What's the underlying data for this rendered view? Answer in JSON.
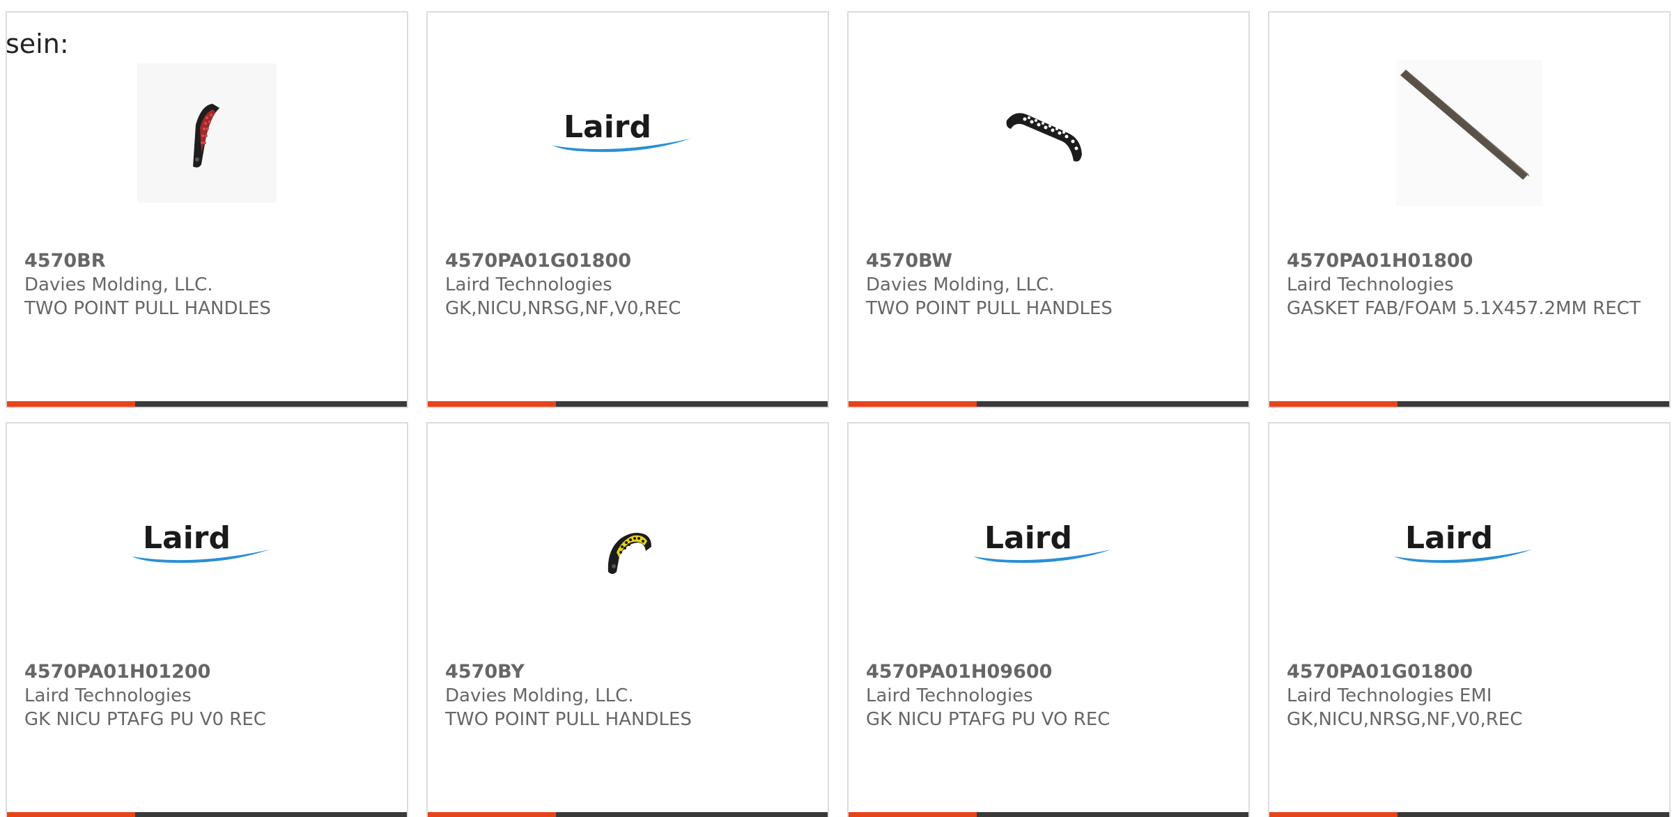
{
  "intro_text": "sein:",
  "accent_color": "#e8431a",
  "bar_color": "#3a3a3a",
  "cards": [
    {
      "part_number": "4570BR",
      "manufacturer": "Davies Molding, LLC.",
      "description": "TWO POINT PULL HANDLES",
      "image": "red-pull-handle-image",
      "progress": 0.32
    },
    {
      "part_number": "4570PA01G01800",
      "manufacturer": "Laird Technologies",
      "description": "GK,NICU,NRSG,NF,V0,REC",
      "image": "laird-logo",
      "logo_text": "Laird",
      "progress": 0.32
    },
    {
      "part_number": "4570BW",
      "manufacturer": "Davies Molding, LLC.",
      "description": "TWO POINT PULL HANDLES",
      "image": "white-dotted-pull-handle-image",
      "progress": 0.32
    },
    {
      "part_number": "4570PA01H01800",
      "manufacturer": "Laird Technologies",
      "description": "GASKET FAB/FOAM 5.1X457.2MM RECT",
      "image": "gasket-strip-image",
      "progress": 0.32
    },
    {
      "part_number": "4570PA01H01200",
      "manufacturer": "Laird Technologies",
      "description": "GK NICU PTAFG PU V0 REC",
      "image": "laird-logo",
      "logo_text": "Laird",
      "progress": 0.32
    },
    {
      "part_number": "4570BY",
      "manufacturer": "Davies Molding, LLC.",
      "description": "TWO POINT PULL HANDLES",
      "image": "yellow-pull-handle-image",
      "progress": 0.32
    },
    {
      "part_number": "4570PA01H09600",
      "manufacturer": "Laird Technologies",
      "description": "GK NICU PTAFG PU VO REC",
      "image": "laird-logo",
      "logo_text": "Laird",
      "progress": 0.32
    },
    {
      "part_number": "4570PA01G01800",
      "manufacturer": "Laird Technologies EMI",
      "description": "GK,NICU,NRSG,NF,V0,REC",
      "image": "laird-logo",
      "logo_text": "Laird",
      "progress": 0.32
    }
  ]
}
